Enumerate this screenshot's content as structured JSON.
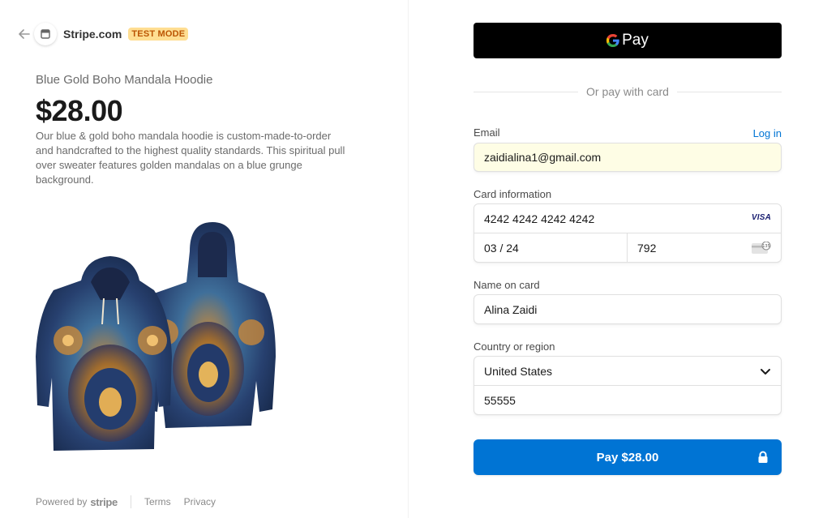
{
  "header": {
    "back_icon": "arrow-left-icon",
    "store_icon": "store-icon",
    "store_name": "Stripe.com",
    "badge": "TEST MODE"
  },
  "product": {
    "name": "Blue Gold Boho Mandala Hoodie",
    "price": "$28.00",
    "description": "Our blue & gold boho mandala hoodie is custom-made-to-order and handcrafted to the highest quality standards. This spiritual pull over sweater features golden mandalas on a blue grunge background."
  },
  "footer": {
    "powered_by": "Powered by",
    "brand": "stripe",
    "terms": "Terms",
    "privacy": "Privacy"
  },
  "payment": {
    "gpay_label": "Pay",
    "or_text": "Or pay with card",
    "email_label": "Email",
    "login_link": "Log in",
    "email_value": "zaidialina1@gmail.com",
    "card_label": "Card information",
    "card_number": "4242 4242 4242 4242",
    "card_brand": "VISA",
    "expiry": "03 / 24",
    "cvc": "792",
    "name_label": "Name on card",
    "name_value": "Alina Zaidi",
    "country_label": "Country or region",
    "country_value": "United States",
    "zip_value": "55555",
    "pay_button": "Pay $28.00"
  },
  "colors": {
    "accent": "#0074d4",
    "badge_bg": "#ffde92",
    "badge_text": "#bb5504",
    "autofill_bg": "#fefde5"
  }
}
